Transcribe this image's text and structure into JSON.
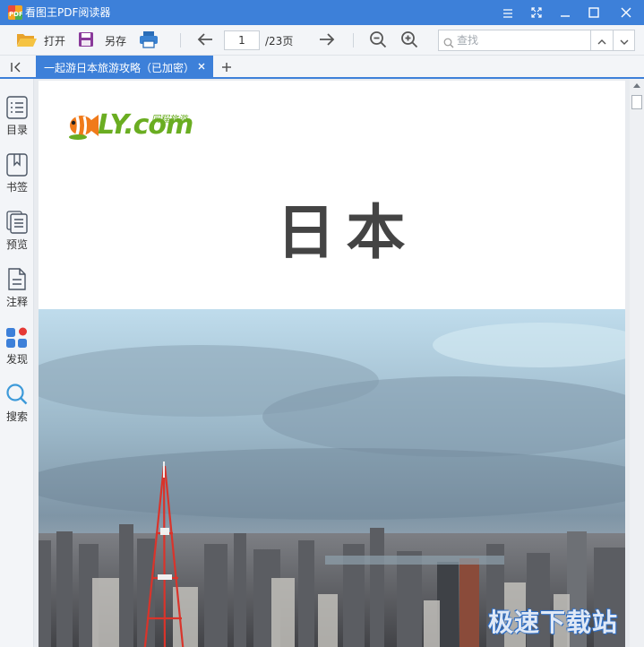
{
  "window": {
    "title": "看图王PDF阅读器",
    "app_icon": "pdf-app-icon",
    "controls": [
      "menu-icon",
      "fullscreen-icon",
      "minimize-icon",
      "maximize-icon",
      "close-icon"
    ]
  },
  "toolbar": {
    "open_label": "打开",
    "save_as_label": "另存",
    "current_page": "1",
    "total_pages": "/23页",
    "search_placeholder": "查找"
  },
  "tabs": {
    "active_title": "一起游日本旅游攻略（已加密）"
  },
  "sidebar": {
    "items": [
      {
        "label": "目录",
        "icon": "toc-icon"
      },
      {
        "label": "书签",
        "icon": "bookmark-icon"
      },
      {
        "label": "预览",
        "icon": "preview-icon"
      },
      {
        "label": "注释",
        "icon": "annotation-icon"
      },
      {
        "label": "发现",
        "icon": "discover-icon"
      },
      {
        "label": "搜索",
        "icon": "search-icon"
      }
    ]
  },
  "document": {
    "brand_name": "LY.com",
    "brand_tagline": "同程旅游",
    "heading": "日本"
  },
  "watermark": "极速下载站",
  "colors": {
    "accent": "#3d80d9",
    "brand_green": "#6aad21",
    "tower_red": "#d9342b"
  }
}
